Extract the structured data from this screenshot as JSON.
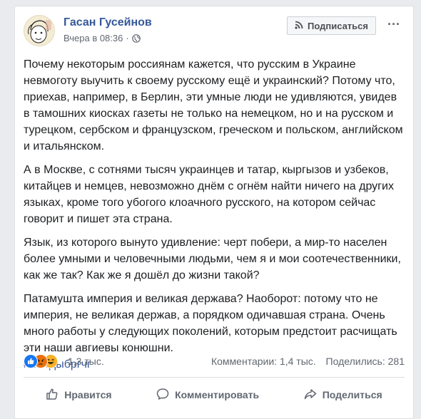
{
  "post": {
    "author": "Гасан Гусейнов",
    "timestamp": "Вчера в 08:36",
    "subscribe_label": "Подписаться",
    "more_label": "···",
    "paragraphs": [
      "Почему некоторым россиянам кажется, что русским в Украине невмоготу выучить к своему русскому ещё и украинский? Потому что, приехав, например, в Берлин, эти умные люди не удивляются, увидев в тамошних киосках газеты не только на немецком, но и на русском и турецком, сербском и французском, греческом и польском, английском и итальянском.",
      "А в Москве, с сотнями тысяч украинцев и татар, кыргызов и узбеков, китайцев и немцев, невозможно днём с огнём найти ничего на других языках, кроме того убогого клоачного русского, на котором сейчас говорит и пишет эта страна.",
      "Язык, из которого вынуто удивление: черт побери, а мир-то населен более умными и человечными людьми, чем я и мои соотечественники, как же так? Как же я дошёл до жизни такой?",
      "Патамушта империя и великая держава? Наоборот: потому что не империя, не великая держав, а порядком одичавшая страна. Очень много работы у следующих поколений, которым предстоит расчищать эти наши авгиевы конюшни."
    ],
    "hashtag": "#пытдыбргчг"
  },
  "reactions": {
    "count": "1,3 тыс.",
    "comments": "Комментарии: 1,4 тыс.",
    "shares": "Поделились: 281",
    "icons": [
      "like-icon",
      "angry-icon",
      "haha-icon"
    ]
  },
  "actions": {
    "like_label": "Нравится",
    "comment_label": "Комментировать",
    "share_label": "Поделиться"
  },
  "colors": {
    "link_blue": "#365899",
    "like_blue": "#1877f2",
    "angry_orange": "#f0743f",
    "haha_yellow": "#f7b125"
  }
}
